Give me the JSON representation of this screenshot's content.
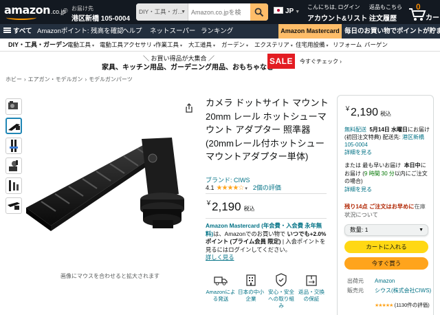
{
  "header": {
    "logo_text": "amazon",
    "logo_tld": ".co.jp",
    "deliver_line1": "お届け先",
    "deliver_line2": "港区新橋 105-0004",
    "search_category": "DIY・工具・ガ...",
    "search_placeholder": "Amazon.co.jpを検",
    "language": "JP",
    "account_line1": "こんにちは, ログイン",
    "account_line2": "アカウント&リスト",
    "returns_line1": "返品もこちら",
    "returns_line2": "注文履歴",
    "cart_count": "0",
    "cart_label": "カート"
  },
  "subnav": {
    "all": "すべて",
    "items": [
      "Amazonポイント: 残高を確認",
      "ヘルプ",
      "ネットスーパー",
      "ランキング"
    ],
    "promo": "Amazon Mastercard",
    "tagline": "毎日のお買い物でポイントが貯ま"
  },
  "categories": [
    "DIY・工具・ガーデン",
    "電動工具",
    "電動工具アクセサリ",
    "作業工具",
    "大工道具",
    "ガーデン",
    "エクステリア",
    "住宅用設備",
    "リフォーム",
    "バーゲン"
  ],
  "banner": {
    "line1": "お買い得品が大集合",
    "line2": "家具、キッチン用品、ガーデニング用品、おもちゃなど",
    "sale": "SALE",
    "check": "今すぐチェック"
  },
  "breadcrumb": [
    "ホビー",
    "エアガン・モデルガン",
    "モデルガンパーツ"
  ],
  "gallery": {
    "hover_note": "画像にマウスを合わせると拡大されます"
  },
  "product": {
    "title": "カメラ ドットサイト マウント 20mm レール ホットシューマウント アダプター 照準器 (20mmレール付ホットシューマウントアダプター単体)",
    "brand": "ブランド: CIWS",
    "rating": "4.1",
    "stars": "★★★★☆",
    "review_count": "2個の評価",
    "price_symbol": "￥",
    "price": "2,190",
    "tax": "税込",
    "mastercard_link": "Amazon Mastercard (年会費・入会費 永年無料)",
    "mastercard_mid": "は、Amazonでのお買い物で ",
    "mastercard_bold": "いつでも+2.0%ポイント (プライム会員 限定)",
    "mastercard_tail": " | 入会ポイントを見るにはログインしてください。",
    "details_link": "詳しく見る",
    "features": [
      {
        "icon": "truck-icon",
        "label": "Amazonによる発送"
      },
      {
        "icon": "building-icon",
        "label": "日本の中小企業"
      },
      {
        "icon": "shield-icon",
        "label": "安心・安全への取り組み"
      },
      {
        "icon": "package-icon",
        "label": "返品・交換の保証"
      }
    ]
  },
  "buybox": {
    "price_symbol": "￥",
    "price": "2,190",
    "tax": "税込",
    "free_delivery": "無料配送",
    "delivery_date": "5月14日 水曜日",
    "delivery_rest": "にお届け (初回注文特典)",
    "ship_to_prefix": " 配送先: ",
    "ship_to": "港区新橋 105-0004",
    "details": "詳細を見る",
    "fast_prefix": "または 最も早いお届け",
    "fast_date": "本日中",
    "fast_mid": "にお届け (",
    "fast_time": "9 時間 30 分",
    "fast_end": "以内にご注文の場合)",
    "stock_left": "残り14点 ご注文はお早めに",
    "stock_rest": "在庫状況について",
    "quantity": "数量: 1",
    "add_to_cart": "カートに入れる",
    "buy_now": "今すぐ買う",
    "meta": [
      {
        "key": "出荷元",
        "value": "Amazon"
      },
      {
        "key": "販売元",
        "value": "シウス(株式会社CIWS)"
      }
    ],
    "seller_rating_count": "(1130件の評価)"
  }
}
